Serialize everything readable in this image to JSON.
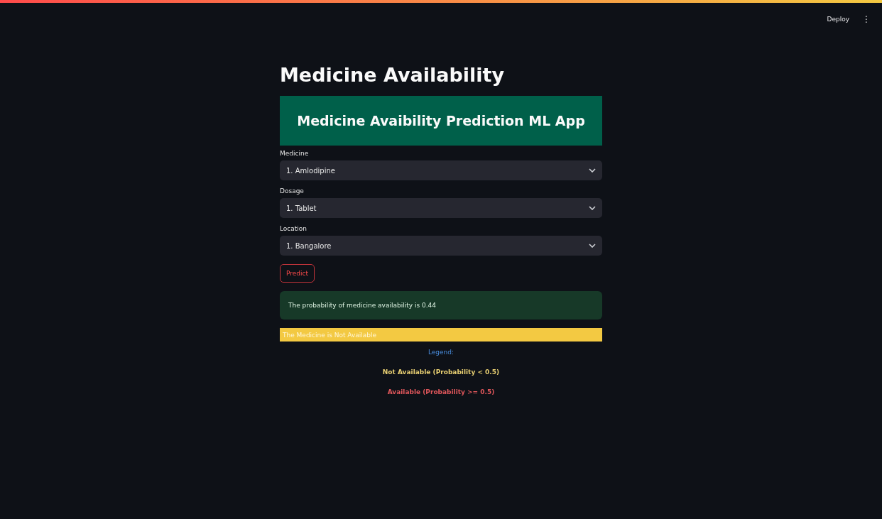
{
  "header": {
    "deploy": "Deploy",
    "menu": "⋮"
  },
  "title": "Medicine Availability",
  "banner": "Medicine Avaibility Prediction ML App",
  "fields": [
    {
      "label": "Medicine",
      "value": "1. Amlodipine"
    },
    {
      "label": "Dosage",
      "value": "1. Tablet"
    },
    {
      "label": "Location",
      "value": "1. Bangalore"
    }
  ],
  "button": "Predict",
  "alerts": [
    {
      "kind": "success",
      "text": "The probability of medicine availability is 0.44"
    },
    {
      "kind": "warning",
      "text": "The Medicine is Not Available"
    }
  ],
  "legend": {
    "title": "Legend:",
    "items": [
      {
        "text": "Not Available (Probability < 0.5)",
        "color": "#e8cf72"
      },
      {
        "text": "Available (Probability >= 0.5)",
        "color": "#e0575b"
      }
    ]
  }
}
